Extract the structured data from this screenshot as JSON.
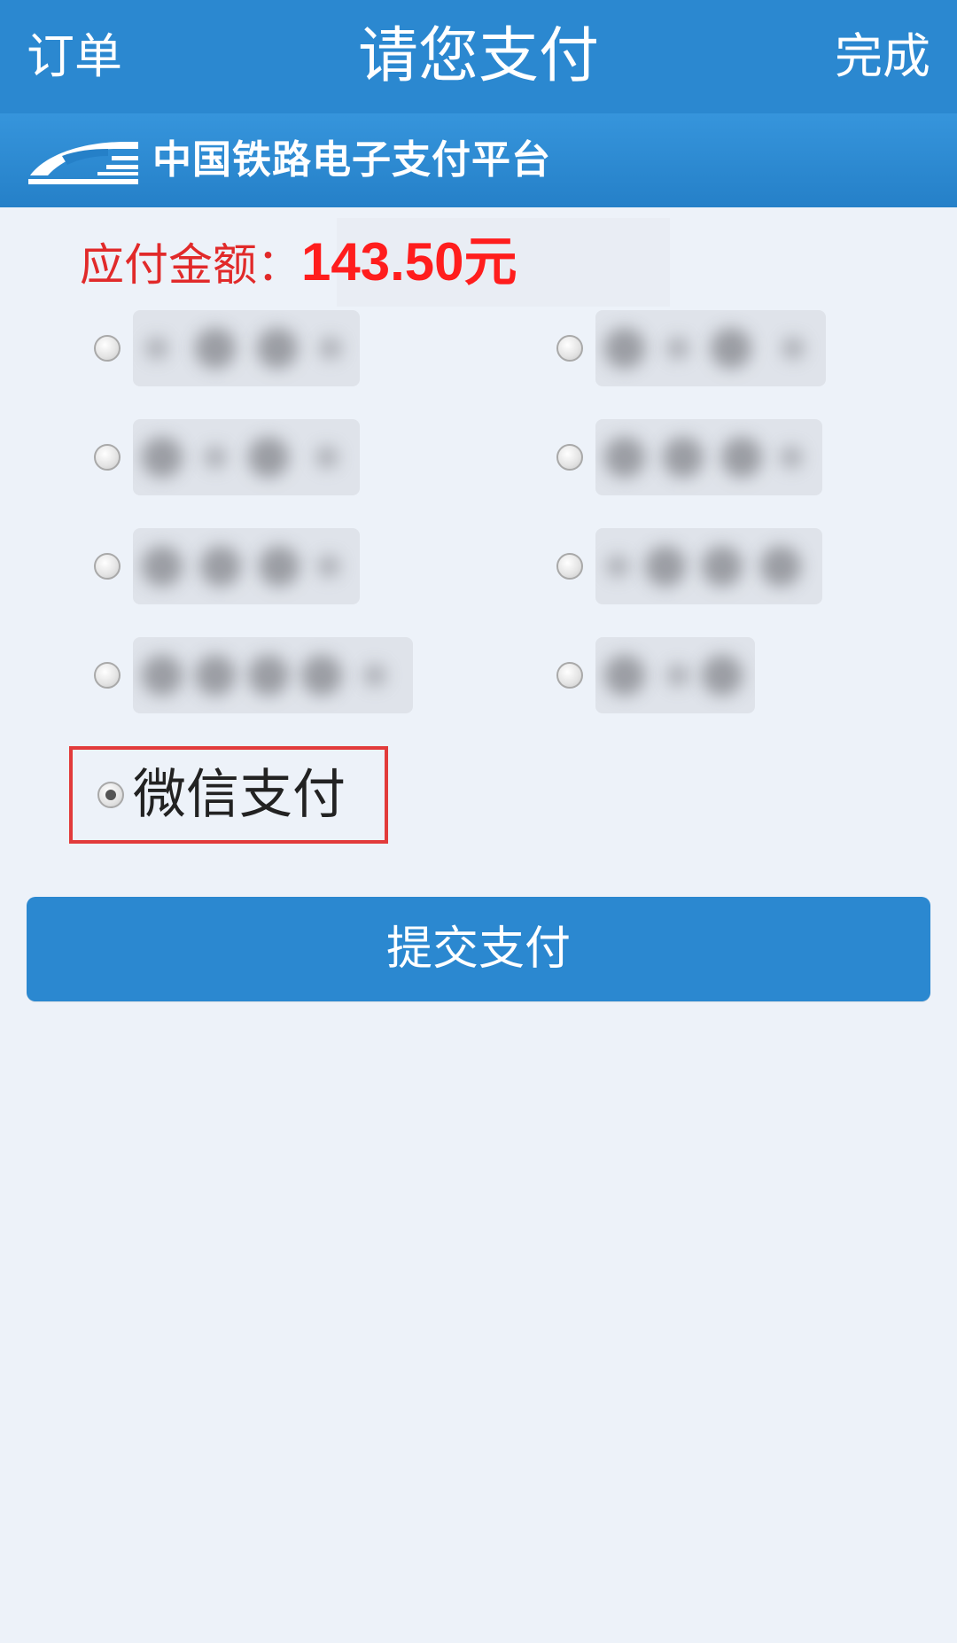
{
  "navbar": {
    "left_label": "订单",
    "title": "请您支付",
    "right_label": "完成"
  },
  "brand": {
    "name": "中国铁路电子支付平台",
    "logo_icon": "train-icon"
  },
  "amount": {
    "label": "应付金额：",
    "value": "143.50元"
  },
  "payment_options": {
    "selected": {
      "label": "微信支付",
      "checked": true
    }
  },
  "submit": {
    "label": "提交支付"
  },
  "colors": {
    "primary": "#2b88d0",
    "amount_red": "#ff1d1d",
    "highlight_border": "#e23b3b",
    "background": "#edf2f9"
  }
}
